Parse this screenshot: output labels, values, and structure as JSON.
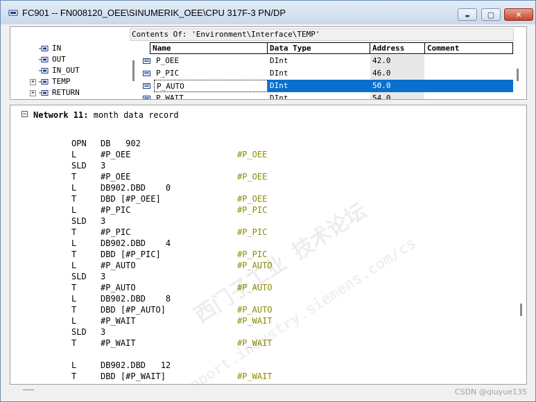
{
  "window": {
    "title": "FC901 -- FN008120_OEE\\SINUMERIK_OEE\\CPU 317F-3 PN/DP",
    "buttons": {
      "minimize": "▬",
      "maximize": "▢",
      "close": "✕"
    }
  },
  "interface": {
    "contents_of": "Contents Of: 'Environment\\Interface\\TEMP'",
    "tree": [
      {
        "label": "IN",
        "expandable": false
      },
      {
        "label": "OUT",
        "expandable": false
      },
      {
        "label": "IN_OUT",
        "expandable": false
      },
      {
        "label": "TEMP",
        "expandable": true
      },
      {
        "label": "RETURN",
        "expandable": true
      }
    ],
    "columns": [
      "Name",
      "Data Type",
      "Address",
      "Comment"
    ],
    "rows": [
      {
        "name": "P_OEE",
        "type": "DInt",
        "address": "42.0",
        "comment": ""
      },
      {
        "name": "P_PIC",
        "type": "DInt",
        "address": "46.0",
        "comment": ""
      },
      {
        "name": "P_AUTO",
        "type": "DInt",
        "address": "50.0",
        "comment": "",
        "selected": true
      },
      {
        "name": "P_WAIT",
        "type": "DInt",
        "address": "54.0",
        "comment": ""
      }
    ]
  },
  "network": {
    "toggle": "−",
    "number_label": "Network 11",
    "separator": ":",
    "comment": "month data record"
  },
  "code": [
    {
      "op": "OPN",
      "arg": "DB   902",
      "cm": ""
    },
    {
      "op": "L",
      "arg": "#P_OEE",
      "cm": "#P_OEE"
    },
    {
      "op": "SLD",
      "arg": "3",
      "cm": ""
    },
    {
      "op": "T",
      "arg": "#P_OEE",
      "cm": "#P_OEE"
    },
    {
      "op": "L",
      "arg": "DB902.DBD    0",
      "cm": ""
    },
    {
      "op": "T",
      "arg": "DBD [#P_OEE]",
      "cm": "#P_OEE"
    },
    {
      "op": "L",
      "arg": "#P_PIC",
      "cm": "#P_PIC"
    },
    {
      "op": "SLD",
      "arg": "3",
      "cm": ""
    },
    {
      "op": "T",
      "arg": "#P_PIC",
      "cm": "#P_PIC"
    },
    {
      "op": "L",
      "arg": "DB902.DBD    4",
      "cm": ""
    },
    {
      "op": "T",
      "arg": "DBD [#P_PIC]",
      "cm": "#P_PIC"
    },
    {
      "op": "L",
      "arg": "#P_AUTO",
      "cm": "#P_AUTO"
    },
    {
      "op": "SLD",
      "arg": "3",
      "cm": ""
    },
    {
      "op": "T",
      "arg": "#P_AUTO",
      "cm": "#P_AUTO"
    },
    {
      "op": "L",
      "arg": "DB902.DBD    8",
      "cm": ""
    },
    {
      "op": "T",
      "arg": "DBD [#P_AUTO]",
      "cm": "#P_AUTO"
    },
    {
      "op": "L",
      "arg": "#P_WAIT",
      "cm": "#P_WAIT"
    },
    {
      "op": "SLD",
      "arg": "3",
      "cm": ""
    },
    {
      "op": "T",
      "arg": "#P_WAIT",
      "cm": "#P_WAIT"
    },
    {
      "op": "",
      "arg": "",
      "cm": ""
    },
    {
      "op": "L",
      "arg": "DB902.DBD   12",
      "cm": ""
    },
    {
      "op": "T",
      "arg": "DBD [#P_WAIT]",
      "cm": "#P_WAIT"
    }
  ],
  "watermark": {
    "line1": "西门子工业 技术论坛",
    "line2": "support.industry.siemens.com/cs"
  },
  "footer": {
    "credit": "CSDN @qiuyue135"
  },
  "colors": {
    "selection": "#0a70d0",
    "comment": "#8b8b00"
  }
}
